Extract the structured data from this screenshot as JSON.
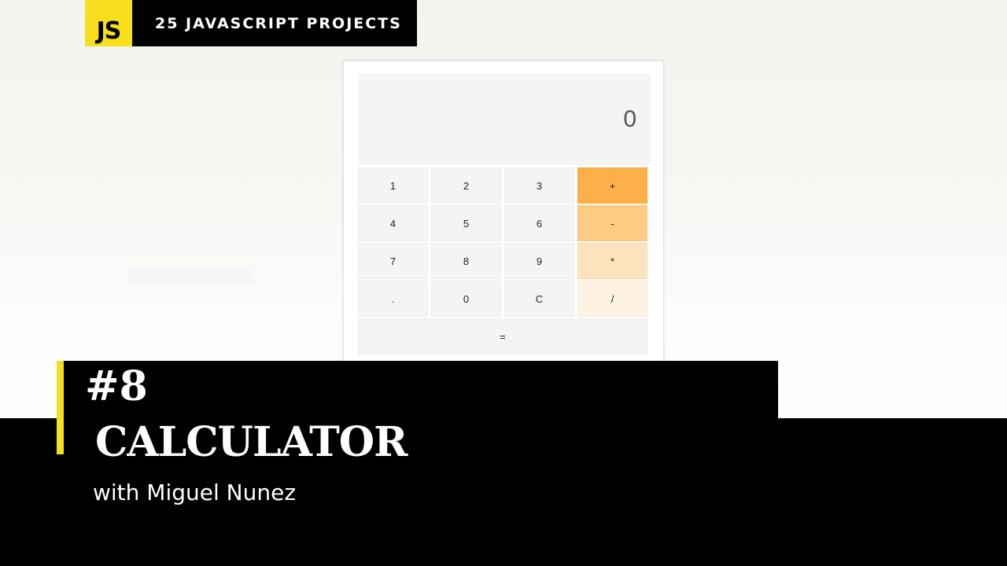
{
  "header": {
    "logo_text": "JS",
    "series_title": "25 JAVASCRIPT PROJECTS"
  },
  "calculator": {
    "display_value": "0",
    "keys": [
      {
        "label": "1"
      },
      {
        "label": "2"
      },
      {
        "label": "3"
      },
      {
        "label": "+"
      },
      {
        "label": "4"
      },
      {
        "label": "5"
      },
      {
        "label": "6"
      },
      {
        "label": "-"
      },
      {
        "label": "7"
      },
      {
        "label": "8"
      },
      {
        "label": "9"
      },
      {
        "label": "*"
      },
      {
        "label": "."
      },
      {
        "label": "0"
      },
      {
        "label": "C"
      },
      {
        "label": "/"
      },
      {
        "label": "="
      }
    ]
  },
  "title": {
    "episode": "#8",
    "name": "CALCULATOR",
    "byline": "with Miguel Nunez"
  },
  "colors": {
    "accent_yellow": "#f7df1e",
    "operator_1": "#fdb04a",
    "operator_2": "#fdcb83",
    "operator_3": "#fde3bd",
    "operator_4": "#fef3e3",
    "banner_black": "#000000"
  }
}
